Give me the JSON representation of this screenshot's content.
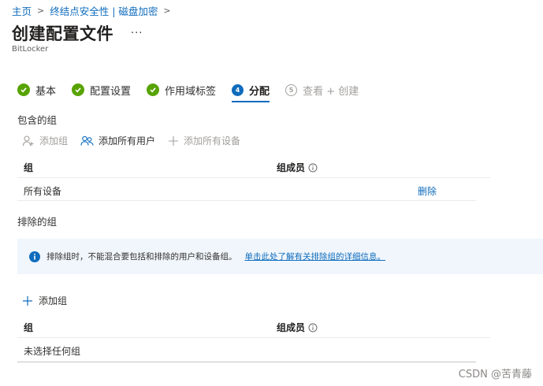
{
  "breadcrumb": {
    "items": [
      {
        "label": "主页"
      },
      {
        "label": "终结点安全性 | 磁盘加密"
      }
    ]
  },
  "header": {
    "title": "创建配置文件",
    "more_label": "···",
    "subtitle": "BitLocker"
  },
  "steps": [
    {
      "label": "基本",
      "state": "done"
    },
    {
      "label": "配置设置",
      "state": "done"
    },
    {
      "label": "作用域标签",
      "state": "done"
    },
    {
      "label": "分配",
      "state": "active",
      "number": "4"
    },
    {
      "label": "查看 + 创建",
      "state": "disabled",
      "number": "5"
    }
  ],
  "included": {
    "section_label": "包含的组",
    "toolbar": {
      "add_group": "添加组",
      "add_all_users": "添加所有用户",
      "add_all_devices": "添加所有设备"
    },
    "columns": {
      "group": "组",
      "members": "组成员"
    },
    "rows": [
      {
        "group": "所有设备",
        "action": "删除"
      }
    ]
  },
  "excluded": {
    "section_label": "排除的组",
    "banner": {
      "text": "排除组时，不能混合要包括和排除的用户和设备组。",
      "link": "单击此处了解有关排除组的详细信息。"
    },
    "add_group": "添加组",
    "columns": {
      "group": "组",
      "members": "组成员"
    },
    "empty_text": "未选择任何组"
  },
  "watermark": "CSDN @苦青藤",
  "colors": {
    "accent": "#0f6cbd",
    "success": "#57a300",
    "disabled": "#a19f9d",
    "banner_bg": "#f0f6fc"
  }
}
